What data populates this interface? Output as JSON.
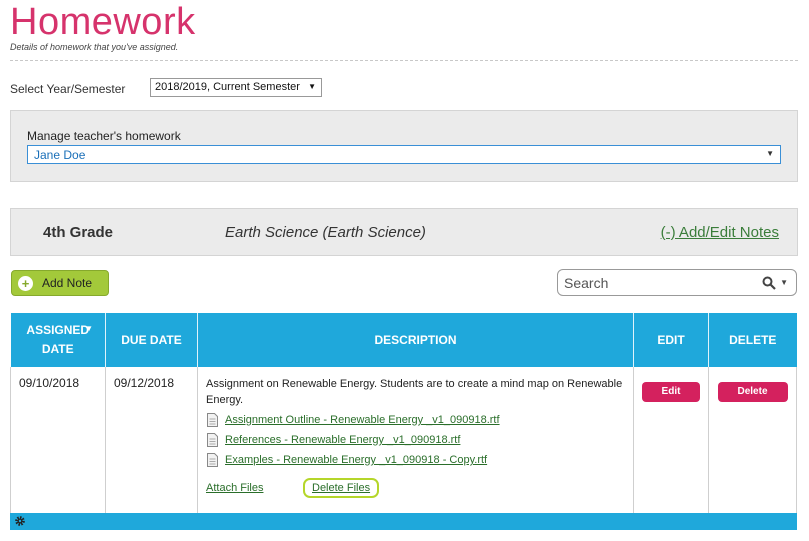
{
  "header": {
    "title": "Homework",
    "subtitle": "Details of homework that you've assigned."
  },
  "year_selector": {
    "label": "Select Year/Semester",
    "selected": "2018/2019, Current Semester"
  },
  "teacher_selector": {
    "label": "Manage teacher's homework",
    "selected": "Jane Doe"
  },
  "class_bar": {
    "grade": "4th Grade",
    "subject": "Earth Science (Earth Science)",
    "notes_link": "(-) Add/Edit Notes"
  },
  "toolbar": {
    "add_note_label": "Add Note",
    "search_placeholder": "Search"
  },
  "table": {
    "columns": {
      "assigned": "ASSIGNED DATE",
      "due": "DUE DATE",
      "description": "DESCRIPTION",
      "edit": "EDIT",
      "delete": "DELETE"
    },
    "rows": [
      {
        "assigned_date": "09/10/2018",
        "due_date": "09/12/2018",
        "description": "Assignment on Renewable Energy. Students are to create a mind map on Renewable Energy.",
        "files": [
          "Assignment Outline - Renewable Energy _v1_090918.rtf",
          "References - Renewable Energy _v1_090918.rtf",
          "Examples - Renewable Energy _v1_090918 - Copy.rtf"
        ],
        "attach_label": "Attach Files",
        "delete_files_label": "Delete Files",
        "edit_label": "Edit",
        "delete_label": "Delete"
      }
    ]
  },
  "colors": {
    "title": "#d6336c",
    "table_header": "#1fa8db",
    "add_button": "#a3c93a",
    "danger_button": "#d4215e",
    "link": "#2a6e2a"
  }
}
